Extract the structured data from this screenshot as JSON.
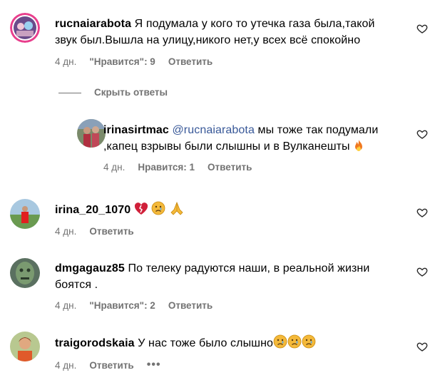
{
  "comments": [
    {
      "username": "rucnaiarabota",
      "text": "Я подумала у кого то утечка газа была,такой звук был.Вышла на улицу,никого нет,у всех всё спокойно",
      "time": "4 дн.",
      "likes": "\"Нравится\": 9",
      "reply": "Ответить"
    },
    {
      "username": "irinasirtmac",
      "mention": "@rucnaiarabota",
      "text": "мы тоже так подумали ,капец взрывы были слышны и в Вулканешты",
      "time": "4 дн.",
      "likes": "Нравится: 1",
      "reply": "Ответить"
    },
    {
      "username": "irina_20_1070",
      "time": "4 дн.",
      "reply": "Ответить"
    },
    {
      "username": "dmgagauz85",
      "text": "По телеку радуются наши, в реальной жизни боятся .",
      "time": "4 дн.",
      "likes": "\"Нравится\": 2",
      "reply": "Ответить"
    },
    {
      "username": "traigorodskaia",
      "text": "У нас тоже было слышно",
      "time": "4 дн.",
      "reply": "Ответить",
      "more": "•••"
    }
  ],
  "hide_replies": "Скрыть ответы",
  "colors": {
    "meta": "#737373",
    "mention": "#385898",
    "emoji_yellow": "#f4b93a"
  },
  "icons": [
    "heart-outline-icon",
    "broken-heart-emoji",
    "sad-face-emoji",
    "praying-hands-emoji",
    "fire-emoji",
    "more-dots-icon"
  ]
}
